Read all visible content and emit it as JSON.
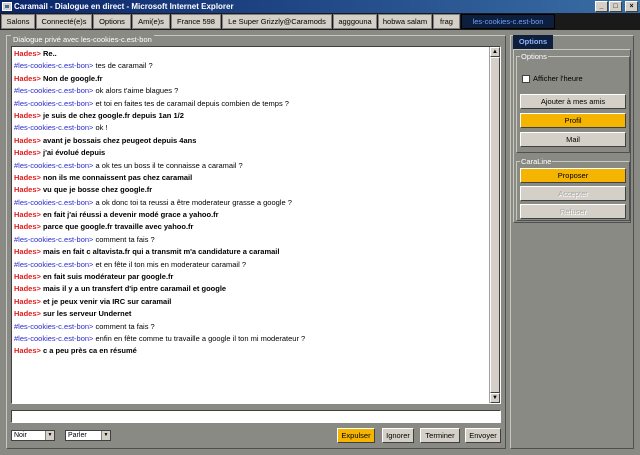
{
  "window": {
    "title": "Caramail - Dialogue en direct - Microsoft Internet Explorer",
    "buttons": {
      "minimize": "_",
      "maximize": "□",
      "close": "×"
    }
  },
  "tabs": [
    {
      "label": "Salons",
      "active": false
    },
    {
      "label": "Connecté(e)s",
      "active": false
    },
    {
      "label": "Options",
      "active": false
    },
    {
      "label": "Ami(e)s",
      "active": false
    },
    {
      "label": "France 598",
      "active": false
    },
    {
      "label": "Le Super Grizzly@Caramods",
      "active": false
    },
    {
      "label": "agggouna",
      "active": false
    },
    {
      "label": "hobwa salam",
      "active": false
    },
    {
      "label": "frag",
      "active": false
    },
    {
      "label": "les-cookies-c.est-bon",
      "active": true
    }
  ],
  "chat": {
    "title": "Dialogue privé avec les-cookies-c.est-bon",
    "messages": [
      {
        "nick": "Hades>",
        "who": "hades",
        "text": "Re..",
        "bold": true
      },
      {
        "nick": "#les-cookies-c.est-bon>",
        "who": "cookies",
        "text": "tes de caramail ?",
        "bold": false
      },
      {
        "nick": "Hades>",
        "who": "hades",
        "text": "Non de google.fr",
        "bold": true
      },
      {
        "nick": "#les-cookies-c.est-bon>",
        "who": "cookies",
        "text": "ok alors t'aime blagues ?",
        "bold": false
      },
      {
        "nick": "#les-cookies-c.est-bon>",
        "who": "cookies",
        "text": "et toi en faites tes de caramail depuis combien de temps ?",
        "bold": false
      },
      {
        "nick": "Hades>",
        "who": "hades",
        "text": "je suis de chez google.fr depuis 1an 1/2",
        "bold": true
      },
      {
        "nick": "#les-cookies-c.est-bon>",
        "who": "cookies",
        "text": "ok !",
        "bold": false
      },
      {
        "nick": "Hades>",
        "who": "hades",
        "text": "avant je bossais chez peugeot depuis 4ans",
        "bold": true
      },
      {
        "nick": "Hades>",
        "who": "hades",
        "text": "j'ai évolué depuis",
        "bold": true
      },
      {
        "nick": "#les-cookies-c.est-bon>",
        "who": "cookies",
        "text": "a ok tes un boss il te connaisse a caramail ?",
        "bold": false
      },
      {
        "nick": "Hades>",
        "who": "hades",
        "text": "non ils me connaissent pas chez caramail",
        "bold": true
      },
      {
        "nick": "Hades>",
        "who": "hades",
        "text": "vu que je bosse chez google.fr",
        "bold": true
      },
      {
        "nick": "#les-cookies-c.est-bon>",
        "who": "cookies",
        "text": "a ok donc toi ta reussi a être moderateur grasse a google ?",
        "bold": false
      },
      {
        "nick": "Hades>",
        "who": "hades",
        "text": "en fait j'ai réussi a devenir modé grace a yahoo.fr",
        "bold": true
      },
      {
        "nick": "Hades>",
        "who": "hades",
        "text": "parce que google.fr travaille avec yahoo.fr",
        "bold": true
      },
      {
        "nick": "#les-cookies-c.est-bon>",
        "who": "cookies",
        "text": "comment ta fais ?",
        "bold": false
      },
      {
        "nick": "Hades>",
        "who": "hades",
        "text": "mais en fait c altavista.fr qui a transmit m'a candidature a caramail",
        "bold": true
      },
      {
        "nick": "#les-cookies-c.est-bon>",
        "who": "cookies",
        "text": "et en fête il ton mis en moderateur caramail ?",
        "bold": false
      },
      {
        "nick": "Hades>",
        "who": "hades",
        "text": "en fait suis modérateur par google.fr",
        "bold": true
      },
      {
        "nick": "Hades>",
        "who": "hades",
        "text": "mais il y a un transfert d'ip entre caramail et google",
        "bold": true
      },
      {
        "nick": "Hades>",
        "who": "hades",
        "text": "et je peux venir via IRC sur caramail",
        "bold": true
      },
      {
        "nick": "Hades>",
        "who": "hades",
        "text": "sur les serveur Undernet",
        "bold": true
      },
      {
        "nick": "#les-cookies-c.est-bon>",
        "who": "cookies",
        "text": "comment ta fais ?",
        "bold": false
      },
      {
        "nick": "#les-cookies-c.est-bon>",
        "who": "cookies",
        "text": "enfin en fête comme tu travaille a google il ton mi moderateur ?",
        "bold": false
      },
      {
        "nick": "Hades>",
        "who": "hades",
        "text": "c a peu près ca en résumé",
        "bold": true
      }
    ],
    "input_value": "",
    "color_select": "Noir",
    "mode_select": "Parler",
    "buttons": {
      "expulser": "Expulser",
      "ignorer": "Ignorer",
      "terminer": "Terminer",
      "envoyer": "Envoyer"
    }
  },
  "side": {
    "tab_label": "Options",
    "options_title": "Options",
    "show_time_label": "Afficher l'heure",
    "show_time_checked": false,
    "add_friend": "Ajouter à mes amis",
    "profil": "Profil",
    "mail": "Mail",
    "caraline_title": "CaraLine",
    "proposer": "Proposer",
    "accepter": "Accepter",
    "refuser": "Refuser"
  },
  "colors": {
    "hades_nick": "#e01b1b",
    "cookies_nick": "#2a2acc",
    "yellow_button": "#f4b400",
    "panel_bg": "#8a8a84",
    "tab_active_bg": "#0d1f3c"
  }
}
